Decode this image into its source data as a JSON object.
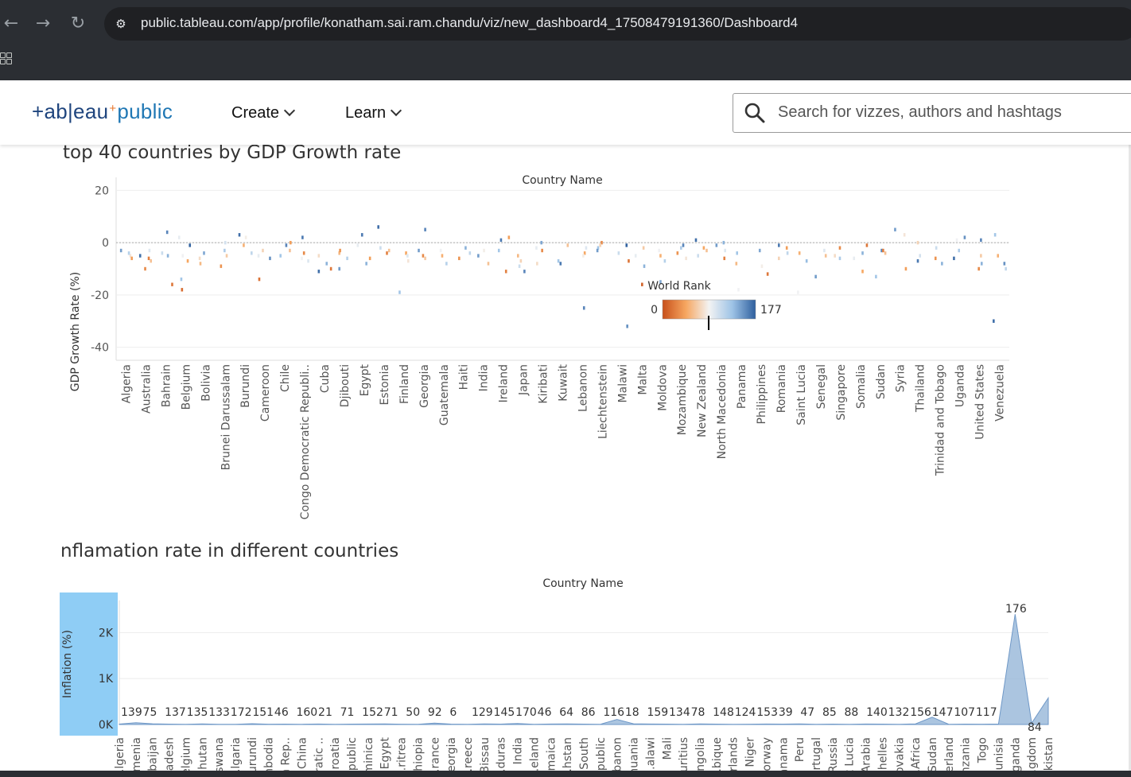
{
  "browser": {
    "url": "public.tableau.com/app/profile/konatham.sai.ram.chandu/viz/new_dashboard4_17508479191360/Dashboard4",
    "back_icon": "←",
    "forward_icon": "→",
    "reload_icon": "↻"
  },
  "header": {
    "logo": {
      "text_left": "+ab|eau",
      "plus": "+",
      "text_right": "public"
    },
    "menu": [
      {
        "label": "Create"
      },
      {
        "label": "Learn"
      }
    ],
    "search_placeholder": "Search for vizzes, authors and hashtags"
  },
  "gdp_chart": {
    "title": "top 40 countries by GDP Growth rate",
    "legend_title": "World Rank",
    "legend_min": "0",
    "legend_max": "177"
  },
  "inflation_chart": {
    "title": "nflamation rate in different countries"
  },
  "chart_data": [
    {
      "type": "scatter",
      "title": "top 40 countries by GDP Growth rate",
      "column_header": "Country Name",
      "ylabel": "GDP Growth Rate (%)",
      "ylim": [
        -45,
        25
      ],
      "yticks": [
        20,
        0,
        -20,
        -40
      ],
      "color_by": "World Rank",
      "color_range": [
        0,
        177
      ],
      "color_scheme": [
        "#c8501a",
        "#f6a660",
        "#f3f3f3",
        "#9ec3e6",
        "#2e5f9e"
      ],
      "categories": [
        "Algeria",
        "Australia",
        "Bahrain",
        "Belgium",
        "Bolivia",
        "Brunei Darussalam",
        "Burundi",
        "Cameroon",
        "Chile",
        "Congo Democratic Republi..",
        "Cuba",
        "Djibouti",
        "Egypt",
        "Estonia",
        "Finland",
        "Georgia",
        "Guatemala",
        "Haiti",
        "India",
        "Ireland",
        "Japan",
        "Kiribati",
        "Kuwait",
        "Lebanon",
        "Liechtenstein",
        "Malawi",
        "Malta",
        "Moldova",
        "Mozambique",
        "New Zealand",
        "North Macedonia",
        "Panama",
        "Philippines",
        "Romania",
        "Saint Lucia",
        "Senegal",
        "Singapore",
        "Somalia",
        "Sudan",
        "Syria",
        "Thailand",
        "Trinidad and Tobago",
        "Uganda",
        "United States",
        "Venezuela"
      ],
      "points": [
        [
          0,
          -5,
          80
        ],
        [
          0,
          -3,
          150
        ],
        [
          0,
          -6,
          40
        ],
        [
          0,
          -4,
          120
        ],
        [
          1,
          -10,
          30
        ],
        [
          1,
          -5,
          170
        ],
        [
          1,
          -7,
          60
        ],
        [
          1,
          -3,
          100
        ],
        [
          1,
          -6,
          25
        ],
        [
          2,
          -5,
          140
        ],
        [
          2,
          -16,
          20
        ],
        [
          2,
          -4,
          110
        ],
        [
          2,
          4,
          160
        ],
        [
          3,
          -18,
          15
        ],
        [
          3,
          -5,
          90
        ],
        [
          3,
          -1,
          175
        ],
        [
          3,
          -7,
          45
        ],
        [
          3,
          -14,
          130
        ],
        [
          3,
          2,
          95
        ],
        [
          4,
          -8,
          55
        ],
        [
          4,
          -4,
          145
        ],
        [
          4,
          -6,
          75
        ],
        [
          5,
          -9,
          35
        ],
        [
          5,
          -3,
          125
        ],
        [
          5,
          0,
          105
        ],
        [
          5,
          -5,
          65
        ],
        [
          6,
          3,
          170
        ],
        [
          6,
          -1,
          50
        ],
        [
          6,
          -4,
          115
        ],
        [
          6,
          2,
          85
        ],
        [
          7,
          -14,
          18
        ],
        [
          7,
          -6,
          155
        ],
        [
          7,
          -3,
          70
        ],
        [
          7,
          -5,
          95
        ],
        [
          8,
          -1,
          160
        ],
        [
          8,
          0,
          40
        ],
        [
          8,
          -5,
          130
        ],
        [
          8,
          -3,
          60
        ],
        [
          9,
          -7,
          100
        ],
        [
          9,
          2,
          165
        ],
        [
          9,
          -4,
          30
        ],
        [
          9,
          -6,
          90
        ],
        [
          10,
          -8,
          140
        ],
        [
          10,
          -10,
          20
        ],
        [
          10,
          -11,
          170
        ],
        [
          10,
          -5,
          75
        ],
        [
          11,
          -4,
          55
        ],
        [
          11,
          -6,
          120
        ],
        [
          11,
          -3,
          35
        ],
        [
          11,
          -10,
          150
        ],
        [
          12,
          -1,
          95
        ],
        [
          12,
          -8,
          140
        ],
        [
          12,
          3,
          165
        ],
        [
          12,
          -6,
          40
        ],
        [
          13,
          -2,
          110
        ],
        [
          13,
          -3,
          60
        ],
        [
          13,
          6,
          170
        ],
        [
          13,
          -4,
          25
        ],
        [
          14,
          -19,
          130
        ],
        [
          14,
          -7,
          80
        ],
        [
          14,
          -4,
          45
        ],
        [
          14,
          -5,
          100
        ],
        [
          15,
          -6,
          65
        ],
        [
          15,
          -3,
          150
        ],
        [
          15,
          -5,
          30
        ],
        [
          15,
          5,
          160
        ],
        [
          16,
          -8,
          120
        ],
        [
          16,
          -3,
          90
        ],
        [
          16,
          -5,
          50
        ],
        [
          17,
          -2,
          140
        ],
        [
          17,
          -6,
          35
        ],
        [
          17,
          -4,
          115
        ],
        [
          18,
          -8,
          60
        ],
        [
          18,
          -5,
          150
        ],
        [
          18,
          -3,
          85
        ],
        [
          19,
          1,
          165
        ],
        [
          19,
          -11,
          25
        ],
        [
          19,
          2,
          40
        ],
        [
          19,
          -3,
          130
        ],
        [
          20,
          -7,
          70
        ],
        [
          20,
          -9,
          110
        ],
        [
          20,
          -5,
          55
        ],
        [
          20,
          -11,
          160
        ],
        [
          21,
          -2,
          95
        ],
        [
          21,
          0,
          145
        ],
        [
          21,
          -3,
          30
        ],
        [
          21,
          -8,
          75
        ],
        [
          22,
          -7,
          130
        ],
        [
          22,
          -1,
          60
        ],
        [
          22,
          -8,
          165
        ],
        [
          23,
          -4,
          45
        ],
        [
          23,
          -25,
          160
        ],
        [
          23,
          -2,
          100
        ],
        [
          23,
          -5,
          85
        ],
        [
          24,
          0,
          30
        ],
        [
          24,
          -2,
          130
        ],
        [
          24,
          -1,
          70
        ],
        [
          24,
          -3,
          150
        ],
        [
          25,
          -1,
          175
        ],
        [
          25,
          -4,
          110
        ],
        [
          25,
          -7,
          20
        ],
        [
          25,
          -32,
          155
        ],
        [
          26,
          -5,
          95
        ],
        [
          26,
          -2,
          65
        ],
        [
          26,
          -9,
          140
        ],
        [
          26,
          -16,
          10
        ],
        [
          27,
          -7,
          120
        ],
        [
          27,
          -5,
          50
        ],
        [
          27,
          -3,
          90
        ],
        [
          27,
          -15,
          145
        ],
        [
          28,
          -1,
          160
        ],
        [
          28,
          -6,
          80
        ],
        [
          28,
          -4,
          35
        ],
        [
          28,
          -2,
          125
        ],
        [
          29,
          -3,
          60
        ],
        [
          29,
          1,
          170
        ],
        [
          29,
          -5,
          110
        ],
        [
          29,
          -2,
          45
        ],
        [
          30,
          -1,
          150
        ],
        [
          30,
          -6,
          25
        ],
        [
          30,
          -3,
          100
        ],
        [
          30,
          0,
          140
        ],
        [
          31,
          -18,
          90
        ],
        [
          31,
          -8,
          55
        ],
        [
          31,
          -4,
          130
        ],
        [
          32,
          -12,
          20
        ],
        [
          32,
          -9,
          85
        ],
        [
          32,
          -3,
          145
        ],
        [
          33,
          -6,
          70
        ],
        [
          33,
          -4,
          115
        ],
        [
          33,
          -2,
          40
        ],
        [
          33,
          -1,
          165
        ],
        [
          34,
          -19,
          90
        ],
        [
          34,
          -7,
          135
        ],
        [
          34,
          -4,
          50
        ],
        [
          35,
          -3,
          100
        ],
        [
          35,
          -5,
          60
        ],
        [
          35,
          -13,
          150
        ],
        [
          36,
          -2,
          30
        ],
        [
          36,
          -6,
          125
        ],
        [
          36,
          -5,
          75
        ],
        [
          37,
          -4,
          140
        ],
        [
          37,
          -1,
          20
        ],
        [
          37,
          -6,
          95
        ],
        [
          37,
          -11,
          45
        ],
        [
          38,
          -3,
          160
        ],
        [
          38,
          -13,
          130
        ],
        [
          38,
          -4,
          60
        ],
        [
          38,
          -3,
          25
        ],
        [
          39,
          -10,
          40
        ],
        [
          39,
          3,
          80
        ],
        [
          39,
          5,
          150
        ],
        [
          40,
          -5,
          105
        ],
        [
          40,
          -7,
          165
        ],
        [
          40,
          0,
          70
        ],
        [
          41,
          -8,
          140
        ],
        [
          41,
          -2,
          110
        ],
        [
          41,
          -6,
          35
        ],
        [
          42,
          2,
          155
        ],
        [
          42,
          1,
          90
        ],
        [
          42,
          -3,
          125
        ],
        [
          42,
          -6,
          170
        ],
        [
          43,
          -10,
          30
        ],
        [
          43,
          -5,
          65
        ],
        [
          43,
          -8,
          140
        ],
        [
          43,
          1,
          160
        ],
        [
          44,
          -10,
          115
        ],
        [
          44,
          -30,
          170
        ],
        [
          44,
          -5,
          50
        ],
        [
          44,
          3,
          130
        ],
        [
          44,
          -8,
          155
        ]
      ]
    },
    {
      "type": "area",
      "title": "nflamation rate in different countries",
      "column_header": "Country Name",
      "ylabel": "Inflation (%)",
      "ylim": [
        0,
        2700
      ],
      "yticks": [
        "2K",
        "1K",
        "0K"
      ],
      "categories": [
        "..lgeria",
        "..rmenia",
        "..baijan",
        "..adesh",
        "..elgium",
        "..hutan",
        "..swana",
        "..lgaria",
        "..urundi",
        "..nbodia",
        "..n Rep..",
        "China",
        "..ratic ..",
        "..roatia",
        "..public",
        "..minica",
        "Egypt",
        "..ritrea",
        "..hiopia",
        "..rance",
        "..eorgia",
        "..reece",
        "..Bissau",
        "..duras",
        "India",
        "..eland",
        "..maica",
        "..hstan",
        "South",
        "..public",
        "..banon",
        "..huania",
        "..alawi",
        "Mali",
        "..uritius",
        "..ngolia",
        "..bique",
        "..rlands",
        "Niger",
        "..orway",
        "..anama",
        "Peru",
        "..rtugal",
        "Russia",
        "..t Lucia",
        "..Arabia",
        "..helles",
        "..ovakia",
        "..Africa",
        "Sudan",
        "..erland",
        "..nzania",
        "Togo",
        "..unisia",
        "..ganda",
        "..gdom",
        "..kistan"
      ],
      "labels": [
        "139",
        "75",
        "137",
        "135",
        "133",
        "172",
        "151",
        "46",
        "160",
        "21",
        "71",
        "152",
        "71",
        "50",
        "92",
        "6",
        "129",
        "145",
        "170",
        "46",
        "64",
        "86",
        "116",
        "18",
        "159",
        "134",
        "78",
        "148",
        "124",
        "153",
        "39",
        "47",
        "85",
        "88",
        "140",
        "132",
        "156",
        "147",
        "107",
        "117",
        "176",
        "84"
      ],
      "values": [
        10,
        40,
        15,
        8,
        5,
        12,
        6,
        4,
        18,
        7,
        9,
        5,
        11,
        6,
        8,
        10,
        14,
        7,
        5,
        30,
        9,
        6,
        12,
        8,
        22,
        4,
        10,
        12,
        9,
        6,
        110,
        15,
        10,
        8,
        6,
        12,
        9,
        5,
        7,
        10,
        8,
        12,
        6,
        9,
        4,
        11,
        8,
        5,
        14,
        160,
        6,
        9,
        7,
        10,
        2400,
        30,
        580
      ]
    }
  ]
}
